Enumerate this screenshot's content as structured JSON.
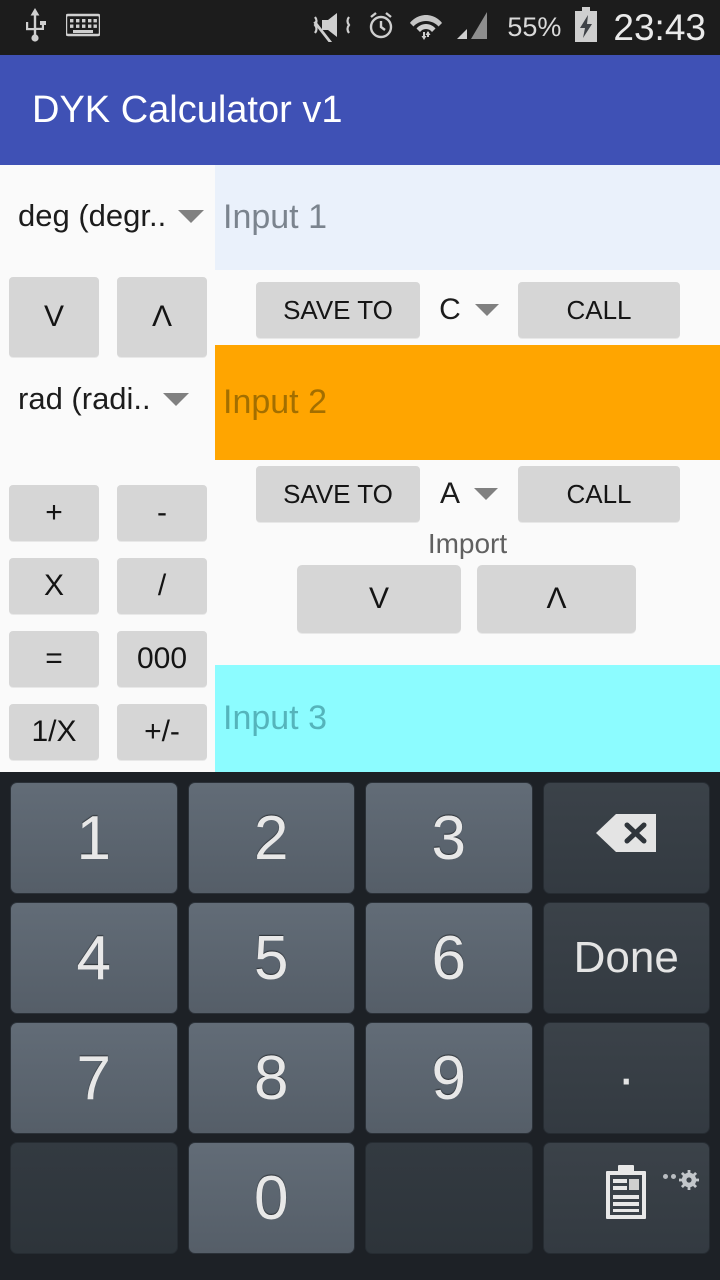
{
  "statusbar": {
    "icons": [
      "usb-icon",
      "keyboard-icon",
      "mute-vibrate-icon",
      "alarm-icon",
      "wifi-icon",
      "signal-icon"
    ],
    "battery_percent": "55%",
    "battery_state": "charging",
    "clock": "23:43"
  },
  "titlebar": {
    "title": "DYK Calculator v1",
    "color": "#3f51b5"
  },
  "left_panel": {
    "angle_spinner_top": "deg (degr..",
    "angle_spinner_bottom": "rad (radi..",
    "nav_down": "V",
    "nav_up": "Λ",
    "ops": [
      "+",
      "-",
      "X",
      "/",
      "=",
      "000",
      "1/X",
      "+/-"
    ]
  },
  "right_panel": {
    "input1": {
      "placeholder": "Input 1",
      "bg": "#eaf1fb"
    },
    "input2": {
      "placeholder": "Input 2",
      "bg": "#ffa500"
    },
    "input3": {
      "placeholder": "Input 3",
      "bg": "#8cfcff"
    },
    "row1": {
      "save_label": "SAVE TO",
      "slot": "C",
      "call_label": "CALL"
    },
    "row2": {
      "save_label": "SAVE TO",
      "slot": "A",
      "call_label": "CALL"
    },
    "import": {
      "label": "Import",
      "down": "V",
      "up": "Λ"
    }
  },
  "keyboard": {
    "rows": [
      [
        {
          "label": "1",
          "type": "num",
          "name": "key-1"
        },
        {
          "label": "2",
          "type": "num",
          "name": "key-2"
        },
        {
          "label": "3",
          "type": "num",
          "name": "key-3"
        },
        {
          "label": "",
          "type": "fn",
          "name": "backspace-icon"
        }
      ],
      [
        {
          "label": "4",
          "type": "num",
          "name": "key-4"
        },
        {
          "label": "5",
          "type": "num",
          "name": "key-5"
        },
        {
          "label": "6",
          "type": "num",
          "name": "key-6"
        },
        {
          "label": "Done",
          "type": "fn",
          "name": "key-done"
        }
      ],
      [
        {
          "label": "7",
          "type": "num",
          "name": "key-7"
        },
        {
          "label": "8",
          "type": "num",
          "name": "key-8"
        },
        {
          "label": "9",
          "type": "num",
          "name": "key-9"
        },
        {
          "label": "·",
          "type": "dot",
          "name": "key-decimal"
        }
      ],
      [
        {
          "label": "",
          "type": "blank",
          "name": "key-blank-left"
        },
        {
          "label": "0",
          "type": "num",
          "name": "key-0"
        },
        {
          "label": "",
          "type": "blank",
          "name": "key-blank-right"
        },
        {
          "label": "",
          "type": "clipboard",
          "name": "clipboard-icon"
        }
      ]
    ]
  }
}
